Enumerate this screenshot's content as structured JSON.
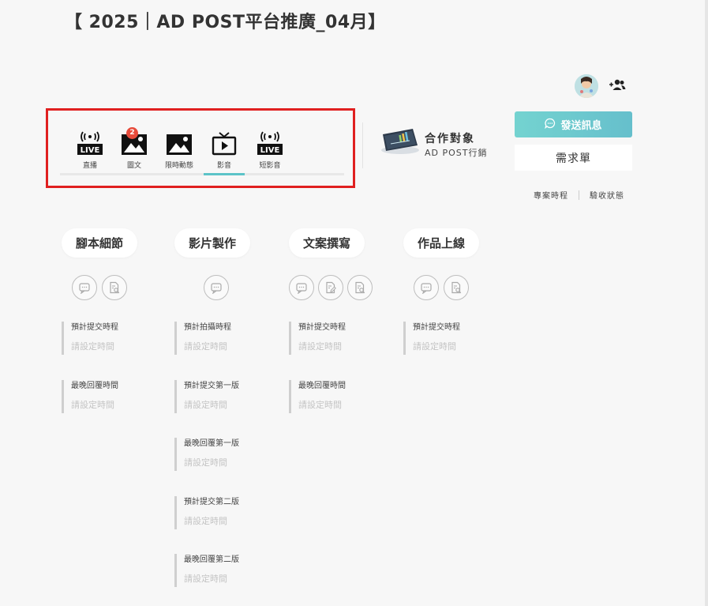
{
  "title": "【 2025｜AD POST平台推廣_04月】",
  "header": {
    "avatar_icon": "user-avatar",
    "add_member_icon": "add-person-icon"
  },
  "platform_tabs": [
    {
      "label": "直播",
      "icon": "live-icon",
      "badge": ""
    },
    {
      "label": "圖文",
      "icon": "image-icon",
      "badge": "2"
    },
    {
      "label": "限時動態",
      "icon": "image-icon",
      "badge": ""
    },
    {
      "label": "影音",
      "icon": "tv-play-icon",
      "badge": "",
      "active": true
    },
    {
      "label": "短影音",
      "icon": "live-icon",
      "badge": ""
    }
  ],
  "partner": {
    "label": "合作對象",
    "name": "AD POST行銷"
  },
  "actions": {
    "send_message": "發送訊息",
    "brief": "需求單",
    "project_schedule": "專案時程",
    "acceptance_status": "驗收狀態"
  },
  "stages": [
    {
      "title": "腳本細節",
      "icons": [
        "chat-icon",
        "document-search-icon"
      ],
      "fields": [
        {
          "label": "預計提交時程",
          "value": "請設定時間"
        },
        {
          "label": "最晚回覆時間",
          "value": "請設定時間"
        }
      ]
    },
    {
      "title": "影片製作",
      "icons": [
        "chat-icon"
      ],
      "fields": [
        {
          "label": "預計拍攝時程",
          "value": "請設定時間"
        },
        {
          "label": "預計提交第一版",
          "value": "請設定時間"
        },
        {
          "label": "最晚回覆第一版",
          "value": "請設定時間"
        },
        {
          "label": "預計提交第二版",
          "value": "請設定時間"
        },
        {
          "label": "最晚回覆第二版",
          "value": "請設定時間"
        }
      ]
    },
    {
      "title": "文案撰寫",
      "icons": [
        "chat-icon",
        "document-edit-icon",
        "document-search-icon"
      ],
      "fields": [
        {
          "label": "預計提交時程",
          "value": "請設定時間"
        },
        {
          "label": "最晚回覆時間",
          "value": "請設定時間"
        }
      ]
    },
    {
      "title": "作品上線",
      "icons": [
        "chat-icon",
        "document-search-icon"
      ],
      "fields": [
        {
          "label": "預計提交時程",
          "value": "請設定時間"
        }
      ]
    }
  ],
  "colors": {
    "accent": "#66c4cc",
    "badge": "#e74c3c",
    "highlight_frame": "#e02020"
  }
}
